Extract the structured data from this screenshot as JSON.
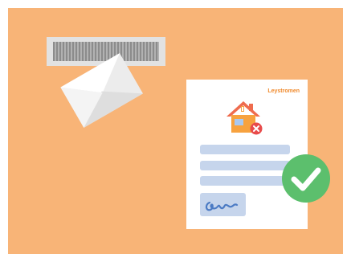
{
  "document": {
    "brand": "Leystromen"
  },
  "icons": {
    "slot": "mail-slot-icon",
    "envelope": "envelope-icon",
    "house": "house-icon",
    "error": "close-circle-icon",
    "signature": "signature-icon",
    "check": "check-circle-icon"
  },
  "colors": {
    "background": "#f8b477",
    "brand": "#f08a2c",
    "placeholder": "#c6d5ec",
    "signature_ink": "#4c7bc4",
    "house_roof": "#ef6c4e",
    "house_body": "#f7a23f",
    "error": "#e84b4b",
    "check": "#5cbf6d"
  }
}
